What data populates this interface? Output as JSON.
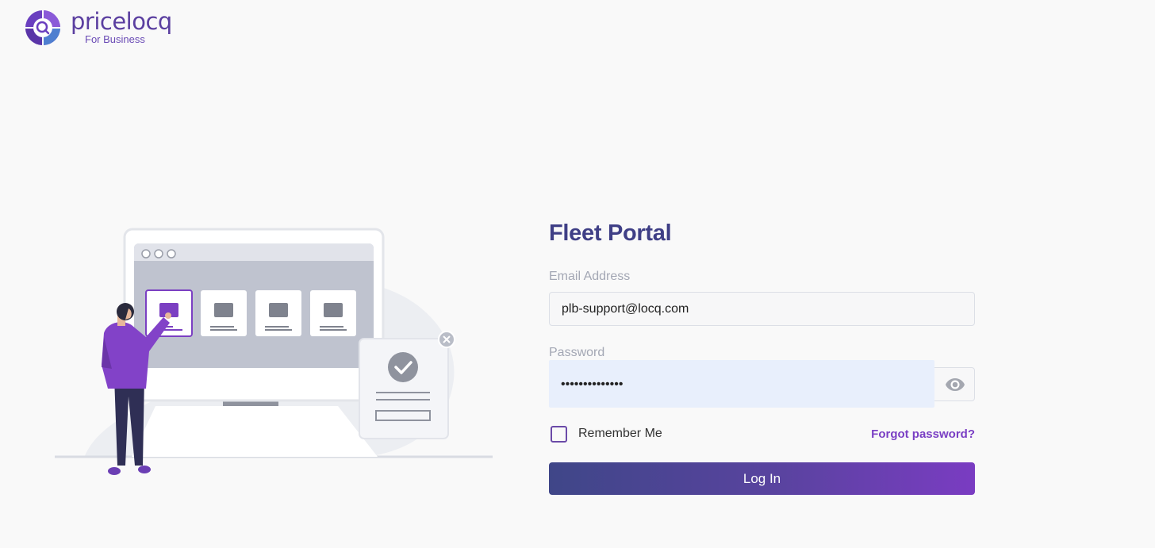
{
  "brand": {
    "name": "pricelocq",
    "tagline": "For Business",
    "primary_color": "#5b3fa0",
    "accent_color": "#7a3cc2"
  },
  "form": {
    "title": "Fleet Portal",
    "email": {
      "label": "Email Address",
      "value": "plb-support@locq.com"
    },
    "password": {
      "label": "Password",
      "masked_value": "••••••••••••••",
      "toggle_icon": "eye-icon"
    },
    "remember_me_label": "Remember Me",
    "forgot_password_label": "Forgot password?",
    "login_button_label": "Log In"
  },
  "illustration": {
    "icon": "check-icon"
  }
}
